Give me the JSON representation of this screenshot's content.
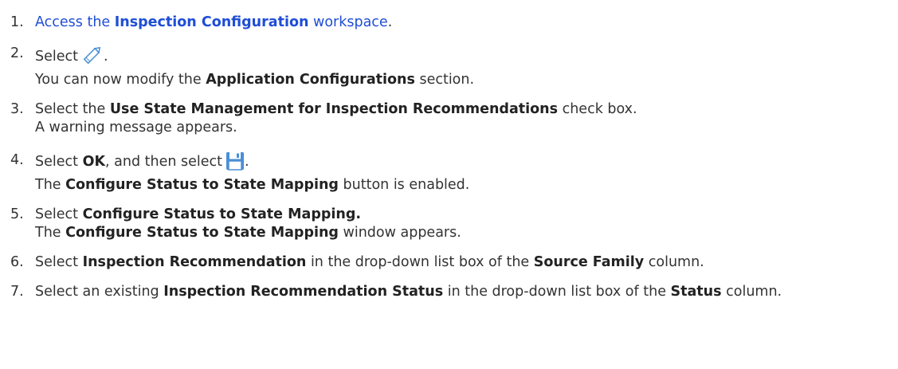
{
  "steps": [
    {
      "number": "1.",
      "link_prefix": "Access the ",
      "link_bold": "Inspection Configuration",
      "link_suffix": " workspace",
      "end": "."
    },
    {
      "number": "2.",
      "line1_text": "Select",
      "line1_icon": "pencil-edit-icon",
      "line1_end": ".",
      "line2_prefix": "You can now modify the ",
      "line2_bold": "Application Configurations",
      "line2_suffix": " section."
    },
    {
      "number": "3.",
      "line1_prefix": "Select the ",
      "line1_bold": "Use State Management for Inspection Recommendations",
      "line1_suffix": " check box.",
      "line2": "A warning message appears."
    },
    {
      "number": "4.",
      "line1_prefix": "Select ",
      "line1_bold": "OK",
      "line1_mid": ", and then select",
      "line1_icon": "save-floppy-icon",
      "line1_end": ".",
      "line2_prefix": "The ",
      "line2_bold": "Configure Status to State Mapping",
      "line2_suffix": " button is enabled."
    },
    {
      "number": "5.",
      "line1_prefix": "Select ",
      "line1_bold": "Configure Status to State Mapping.",
      "line2_prefix": "The ",
      "line2_bold": "Configure Status to State Mapping",
      "line2_suffix": " window appears."
    },
    {
      "number": "6.",
      "prefix": "Select ",
      "bold1": "Inspection Recommendation",
      "mid": " in the drop-down list box of the ",
      "bold2": "Source Family",
      "suffix": " column."
    },
    {
      "number": "7.",
      "prefix": "Select an existing ",
      "bold1": "Inspection Recommendation Status",
      "mid": " in the drop-down list box of the ",
      "bold2": "Status",
      "suffix": " column."
    }
  ],
  "colors": {
    "link": "#1f4ed6",
    "text": "#333333",
    "icon_blue": "#4a8fd6"
  }
}
